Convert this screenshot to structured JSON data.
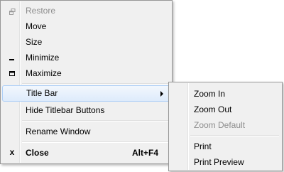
{
  "window_menu": {
    "restore": "Restore",
    "move": "Move",
    "size": "Size",
    "minimize": "Minimize",
    "maximize": "Maximize",
    "title_bar": "Title Bar",
    "hide_titlebar_buttons": "Hide Titlebar Buttons",
    "rename_window": "Rename Window",
    "close": "Close",
    "close_shortcut": "Alt+F4",
    "close_glyph": "x"
  },
  "title_bar_submenu": {
    "zoom_in": "Zoom In",
    "zoom_out": "Zoom Out",
    "zoom_default": "Zoom Default",
    "print": "Print",
    "print_preview": "Print Preview"
  },
  "colors": {
    "menu_bg": "#f0f0f0",
    "highlight_border": "#aecff7",
    "disabled_text": "#8d8d8d"
  }
}
